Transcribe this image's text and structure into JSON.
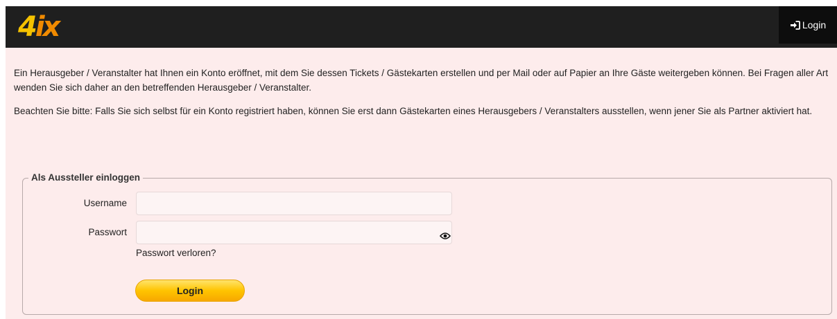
{
  "header": {
    "logo_text_main": "4",
    "logo_text_accent": "ix",
    "login_label": "Login"
  },
  "intro": {
    "paragraph_1": "Ein Herausgeber / Veranstalter hat Ihnen ein Konto eröffnet, mit dem Sie dessen Tickets / Gästekarten erstellen und per Mail oder auf Papier an Ihre Gäste weitergeben können. Bei Fragen aller Art wenden Sie sich daher an den betreffenden Herausgeber / Veranstalter.",
    "paragraph_2": "Beachten Sie bitte: Falls Sie sich selbst für ein Konto registriert haben, können Sie erst dann Gästekarten eines Herausgebers / Veranstalters ausstellen, wenn jener Sie als Partner aktiviert hat."
  },
  "login_form": {
    "legend": "Als Aussteller einloggen",
    "username_label": "Username",
    "username_value": "",
    "password_label": "Passwort",
    "password_value": "",
    "forgot_link": "Passwort verloren?",
    "submit_label": "Login"
  },
  "colors": {
    "header_bg": "#1f1f1f",
    "page_bg": "#fdecec",
    "button_accent": "#ffc400",
    "logo_yellow": "#f5c200"
  },
  "icons": {
    "login": "sign-in-icon",
    "password_toggle": "eye-icon"
  }
}
